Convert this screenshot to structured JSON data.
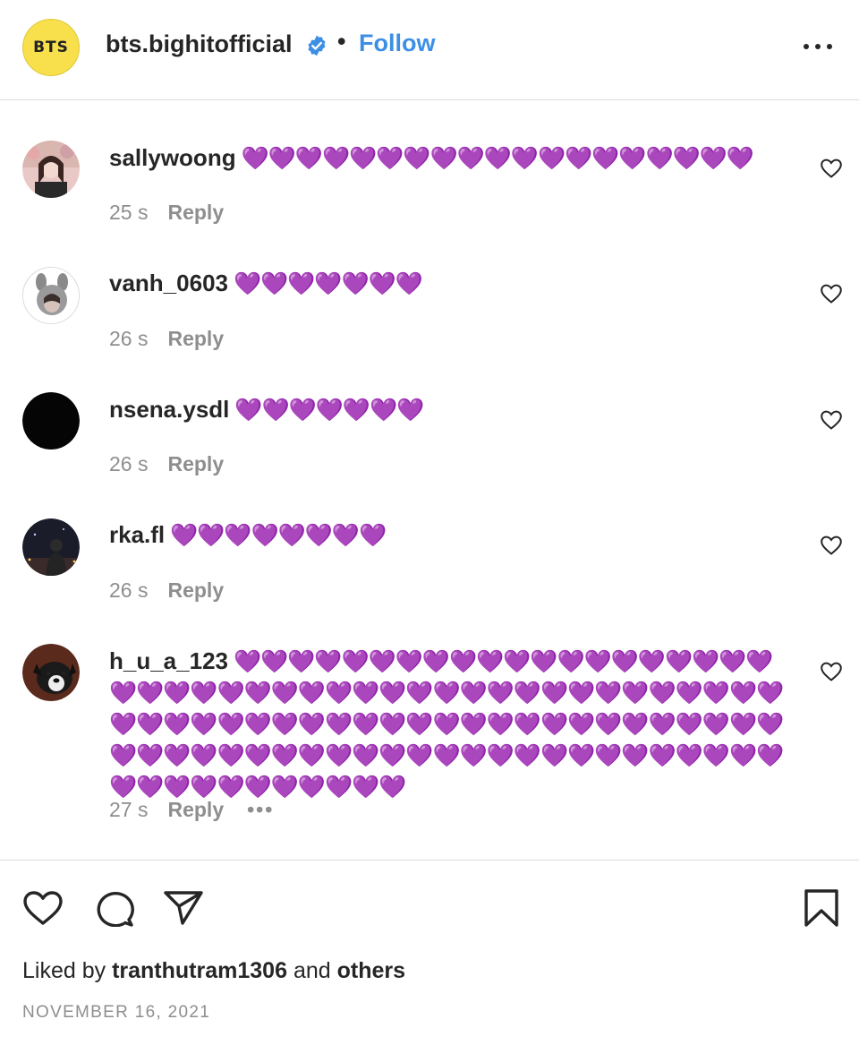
{
  "header": {
    "avatar_text": "BTS",
    "username": "bts.bighitofficial",
    "separator": "•",
    "follow_label": "Follow",
    "verified_icon": "verified-badge-icon",
    "more_icon": "more-horizontal-icon"
  },
  "comments": [
    {
      "username": "sallywoong",
      "hearts": "💜💜💜💜💜💜💜💜💜💜💜💜💜💜💜💜💜💜💜",
      "time": "25 s",
      "reply": "Reply"
    },
    {
      "username": "vanh_0603",
      "hearts": "💜💜💜💜💜💜💜",
      "time": "26 s",
      "reply": "Reply"
    },
    {
      "username": "nsena.ysdl",
      "hearts": "💜💜💜💜💜💜💜",
      "time": "26 s",
      "reply": "Reply"
    },
    {
      "username": "rka.fl",
      "hearts": "💜💜💜💜💜💜💜💜",
      "time": "26 s",
      "reply": "Reply"
    },
    {
      "username": "h_u_a_123",
      "hearts": "💜💜💜💜💜💜💜💜💜💜💜💜💜💜💜💜💜💜💜💜💜💜💜💜💜💜💜💜💜💜💜💜💜💜💜💜💜💜💜💜💜💜💜💜💜💜💜💜💜💜💜💜💜💜💜💜💜💜💜💜💜💜💜💜💜💜💜💜💜💜💜💜💜💜💜💜💜💜💜💜💜💜💜💜💜💜💜💜💜💜💜💜💜💜💜💜💜💜💜💜💜💜💜💜💜💜",
      "time": "27 s",
      "reply": "Reply",
      "more": "•••"
    }
  ],
  "actions": {
    "like_icon": "heart-icon",
    "comment_icon": "comment-bubble-icon",
    "share_icon": "paper-plane-icon",
    "save_icon": "bookmark-icon"
  },
  "likes": {
    "prefix": "Liked by",
    "user": "tranthutram1306",
    "middle": "and",
    "suffix": "others"
  },
  "date": "NOVEMBER 16, 2021",
  "colors": {
    "accent": "#3d8fe6",
    "heart_purple": "#9b3ff0",
    "avatar_yellow": "#f7e04b"
  }
}
